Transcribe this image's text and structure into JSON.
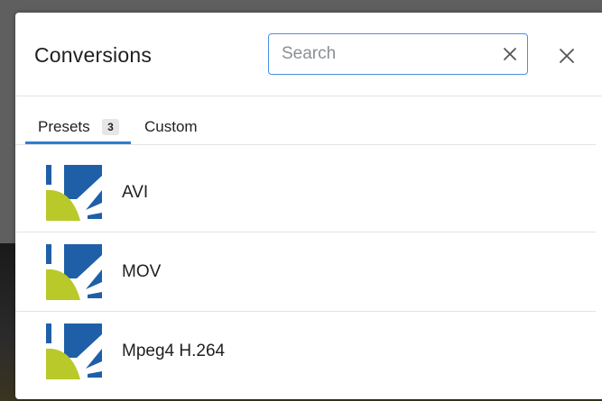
{
  "dialog": {
    "title": "Conversions",
    "search": {
      "placeholder": "Search",
      "value": ""
    },
    "clear_icon": "clear-x-icon",
    "close_icon": "close-icon"
  },
  "tabs": [
    {
      "label": "Presets",
      "badge": "3",
      "active": true
    },
    {
      "label": "Custom",
      "active": false
    }
  ],
  "presets": [
    {
      "label": "AVI",
      "icon": "preset-icon"
    },
    {
      "label": "MOV",
      "icon": "preset-icon"
    },
    {
      "label": "Mpeg4 H.264",
      "icon": "preset-icon"
    }
  ],
  "colors": {
    "accent": "#2d7fd3",
    "icon_blue": "#1f5fa8",
    "icon_green": "#b9c92a"
  }
}
